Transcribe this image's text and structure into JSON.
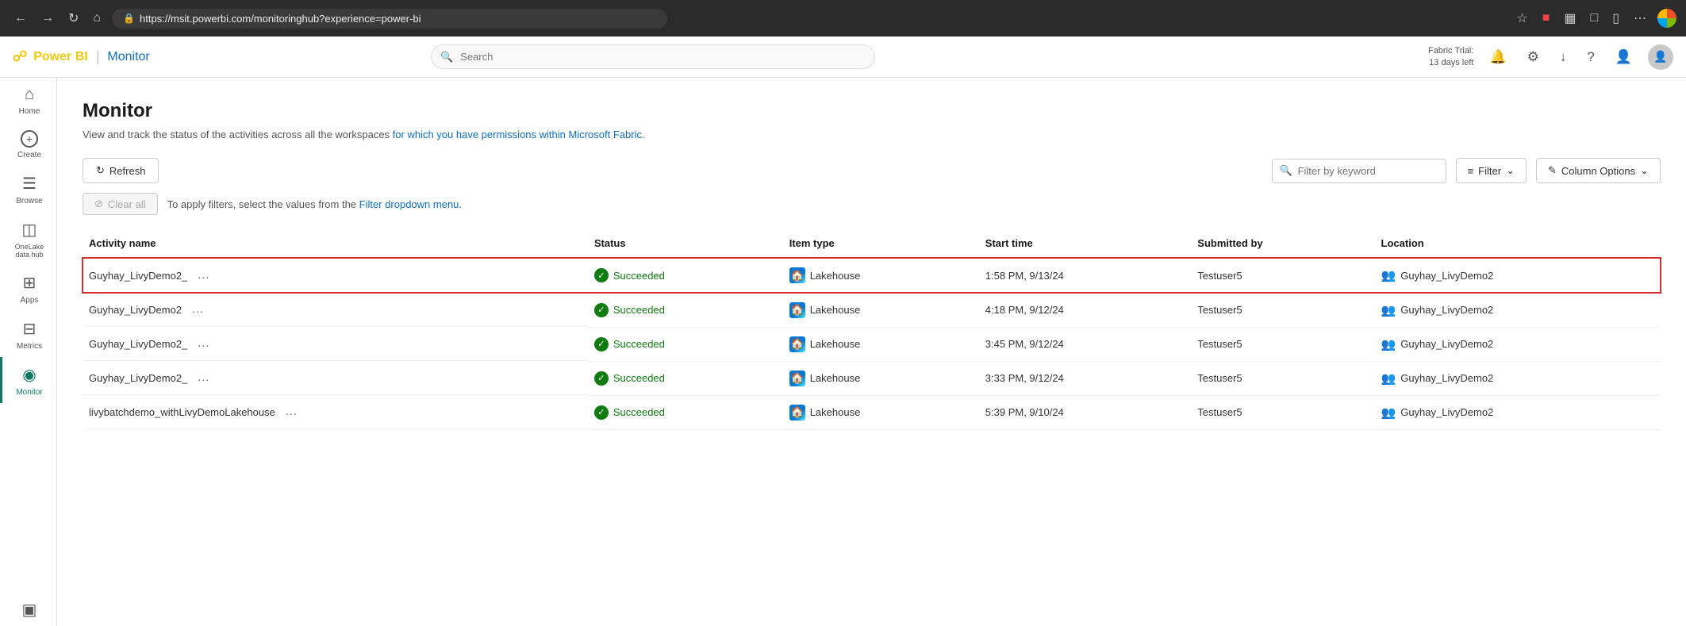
{
  "browser": {
    "url": "https://msit.powerbi.com/monitoringhub?experience=power-bi",
    "back_label": "←",
    "forward_label": "→",
    "refresh_label": "↻",
    "home_label": "⌂"
  },
  "topbar": {
    "brand_powerbi": "Power BI",
    "brand_monitor": "Monitor",
    "search_placeholder": "Search",
    "fabric_trial_line1": "Fabric Trial:",
    "fabric_trial_line2": "13 days left"
  },
  "sidebar": {
    "items": [
      {
        "id": "home",
        "label": "Home",
        "icon": "⌂"
      },
      {
        "id": "create",
        "label": "Create",
        "icon": "+"
      },
      {
        "id": "browse",
        "label": "Browse",
        "icon": "☰"
      },
      {
        "id": "onelake",
        "label": "OneLake data hub",
        "icon": "◫"
      },
      {
        "id": "apps",
        "label": "Apps",
        "icon": "⊞"
      },
      {
        "id": "metrics",
        "label": "Metrics",
        "icon": "⊟"
      },
      {
        "id": "monitor",
        "label": "Monitor",
        "icon": "◉",
        "active": true
      },
      {
        "id": "workspaces",
        "label": "",
        "icon": "▣"
      }
    ]
  },
  "page": {
    "title": "Monitor",
    "subtitle": "View and track the status of the activities across all the workspaces for which you have permissions within Microsoft Fabric.",
    "subtitle_link_text": "for which you have permissions within Microsoft Fabric."
  },
  "toolbar": {
    "refresh_label": "Refresh",
    "filter_placeholder": "Filter by keyword",
    "filter_label": "Filter",
    "column_options_label": "Column Options"
  },
  "filter_bar": {
    "clear_label": "Clear all",
    "hint_text": "To apply filters, select the values from the",
    "hint_link": "Filter dropdown menu."
  },
  "table": {
    "columns": [
      {
        "id": "activity_name",
        "label": "Activity name"
      },
      {
        "id": "status",
        "label": "Status"
      },
      {
        "id": "item_type",
        "label": "Item type"
      },
      {
        "id": "start_time",
        "label": "Start time"
      },
      {
        "id": "submitted_by",
        "label": "Submitted by"
      },
      {
        "id": "location",
        "label": "Location"
      }
    ],
    "rows": [
      {
        "activity_name": "Guyhay_LivyDemo2_",
        "status": "Succeeded",
        "item_type": "Lakehouse",
        "start_time": "1:58 PM, 9/13/24",
        "submitted_by": "Testuser5",
        "location": "Guyhay_LivyDemo2",
        "highlighted": true
      },
      {
        "activity_name": "Guyhay_LivyDemo2",
        "status": "Succeeded",
        "item_type": "Lakehouse",
        "start_time": "4:18 PM, 9/12/24",
        "submitted_by": "Testuser5",
        "location": "Guyhay_LivyDemo2",
        "highlighted": false
      },
      {
        "activity_name": "Guyhay_LivyDemo2_",
        "status": "Succeeded",
        "item_type": "Lakehouse",
        "start_time": "3:45 PM, 9/12/24",
        "submitted_by": "Testuser5",
        "location": "Guyhay_LivyDemo2",
        "highlighted": false
      },
      {
        "activity_name": "Guyhay_LivyDemo2_",
        "status": "Succeeded",
        "item_type": "Lakehouse",
        "start_time": "3:33 PM, 9/12/24",
        "submitted_by": "Testuser5",
        "location": "Guyhay_LivyDemo2",
        "highlighted": false
      },
      {
        "activity_name": "livybatchdemo_withLivyDemoLakehouse",
        "status": "Succeeded",
        "item_type": "Lakehouse",
        "start_time": "5:39 PM, 9/10/24",
        "submitted_by": "Testuser5",
        "location": "Guyhay_LivyDemo2",
        "highlighted": false
      }
    ]
  },
  "colors": {
    "accent_green": "#117865",
    "brand_yellow": "#f2c811",
    "brand_blue": "#106ebe",
    "highlight_red": "#d32f2f",
    "success_green": "#107c10"
  }
}
